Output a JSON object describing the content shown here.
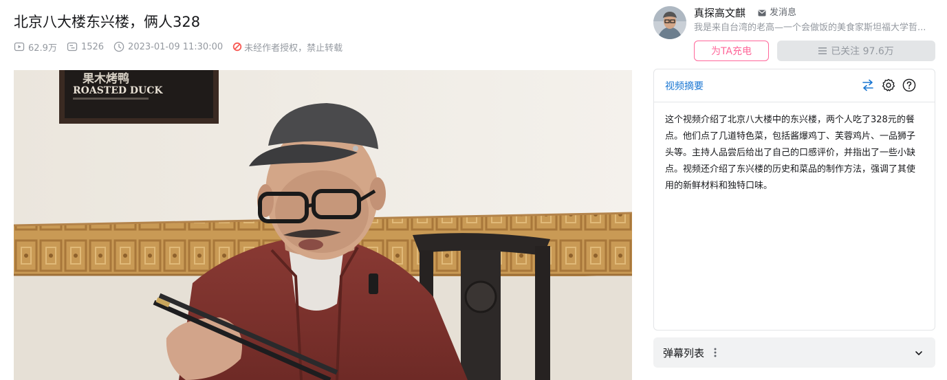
{
  "video": {
    "title": "北京八大楼东兴楼，俩人328",
    "views": "62.9万",
    "danmaku_count": "1526",
    "publish_time": "2023-01-09 11:30:00",
    "copyright_notice": "未经作者授权，禁止转载"
  },
  "player": {
    "frame_sign": {
      "line1": "果木烤鸭",
      "line2": "ROASTED DUCK"
    },
    "icon": "video-frame"
  },
  "uploader": {
    "name": "真探高文麒",
    "message_label": "发消息",
    "description": "我是来自台湾的老高—一个会做饭的美食家斯坦福大学哲...",
    "charge_label": "为TA充电",
    "follow_label": "已关注 97.6万"
  },
  "summary": {
    "tab_label": "视频摘要",
    "text": "这个视频介绍了北京八大楼中的东兴楼，两个人吃了328元的餐点。他们点了几道特色菜，包括酱爆鸡丁、芙蓉鸡片、一品狮子头等。主持人品尝后给出了自己的口感评价，并指出了一些小缺点。视频还介绍了东兴楼的历史和菜品的制作方法，强调了其使用的新鲜材料和独特口味。",
    "tools": [
      "swap-icon",
      "gear-icon",
      "help-icon"
    ]
  },
  "danmaku_list": {
    "title": "弹幕列表",
    "more_icon": "more-vertical-icon",
    "expand_icon": "chevron-down-icon"
  },
  "colors": {
    "accent_pink": "#ff6699",
    "accent_blue": "#1976d2",
    "warn_red": "#f85a54",
    "muted_text": "#9499a0"
  }
}
